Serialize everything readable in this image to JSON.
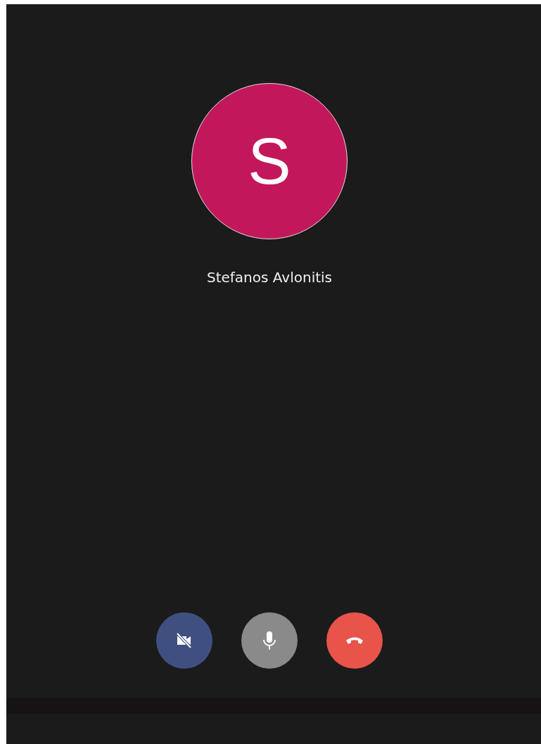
{
  "caller": {
    "initial": "S",
    "color": "#c2185b",
    "name": "Stefanos Avlonitis"
  },
  "controls": [
    {
      "kind": "camera",
      "on": false
    },
    {
      "kind": "mic",
      "on": true
    },
    {
      "kind": "hangup"
    }
  ]
}
